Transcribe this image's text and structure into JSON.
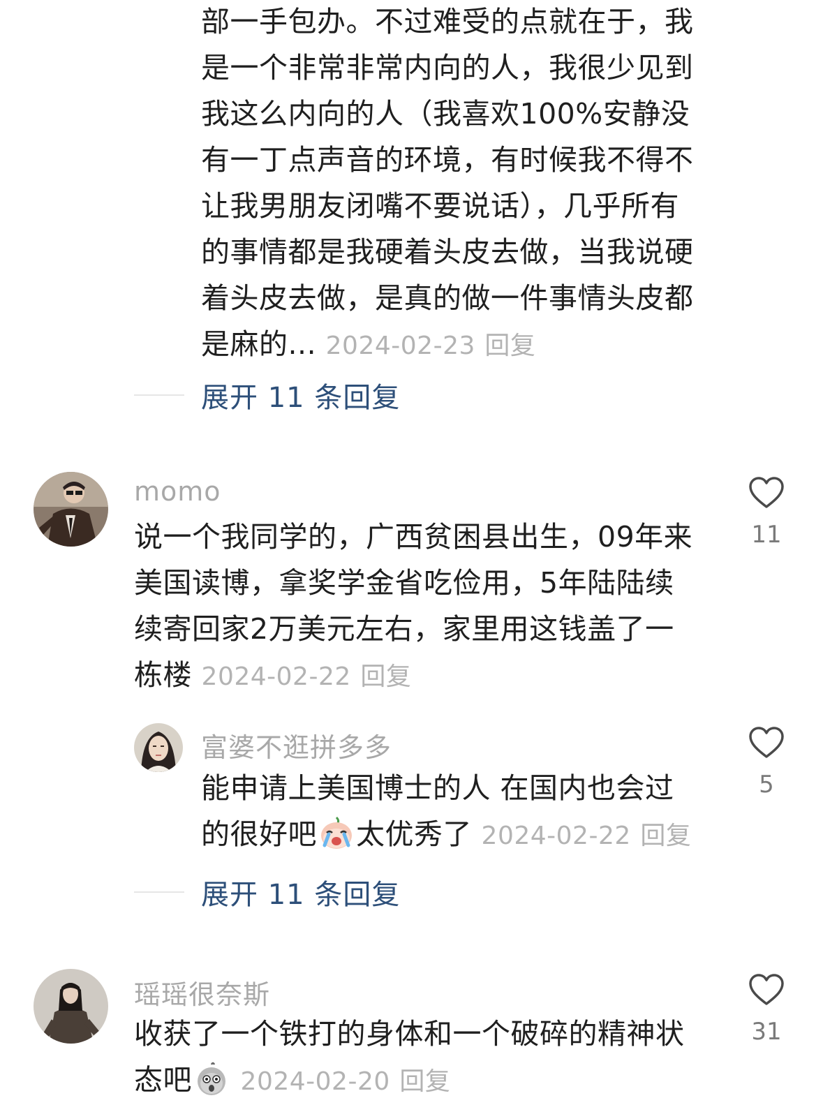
{
  "top_comment": {
    "lines": [
      "部一手包办。不过难受的点就在于，我",
      "是一个非常非常内向的人，我很少见到",
      "我这么内向的人（我喜欢100%安静没",
      "有一丁点声音的环境，有时候我不得不",
      "让我男朋友闭嘴不要说话），几乎所有",
      "的事情都是我硬着头皮去做，当我说硬",
      "着头皮去做，是真的做一件事情头皮都"
    ],
    "last_line": "是麻的...",
    "date": "2024-02-23",
    "reply_label": "回复",
    "expand_label": "展开 11 条回复"
  },
  "comment_momo": {
    "username": "momo",
    "lines": [
      "说一个我同学的，广西贫困县出生，09年来",
      "美国读博，拿奖学金省吃俭用，5年陆陆续",
      "续寄回家2万美元左右，家里用这钱盖了一"
    ],
    "last_line": "栋楼",
    "date": "2024-02-22",
    "reply_label": "回复",
    "likes": "11",
    "reply": {
      "username": "富婆不逛拼多多",
      "line1": "能申请上美国博士的人 在国内也会过",
      "line2_before": "的很好吧",
      "line2_after": "太优秀了",
      "emoji": "crying-emoji",
      "date": "2024-02-22",
      "reply_label": "回复",
      "likes": "5"
    },
    "expand_label": "展开 11 条回复"
  },
  "comment_yaoyao": {
    "username": "瑶瑶很奈斯",
    "line1": "收获了一个铁打的身体和一个破碎的精神状",
    "line2_before": "态吧",
    "emoji": "shocked-emoji",
    "date": "2024-02-20",
    "reply_label": "回复",
    "likes": "31"
  },
  "colors": {
    "link": "#2d4f79",
    "meta": "#b3b3b3",
    "username": "#a8a8a8",
    "text": "#1f1f1f"
  }
}
